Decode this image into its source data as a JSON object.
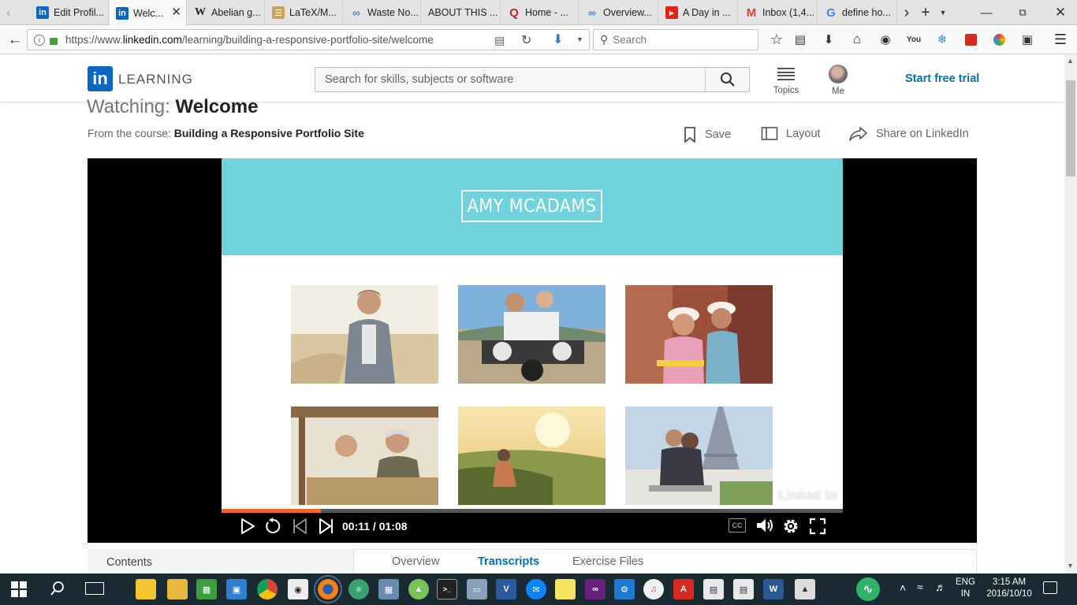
{
  "browser": {
    "tabs": [
      {
        "label": "Edit Profil...",
        "icon": "linkedin-icon",
        "active": false
      },
      {
        "label": "Welc...",
        "icon": "linkedin-icon",
        "active": true
      },
      {
        "label": "Abelian g...",
        "icon": "wikipedia-icon",
        "active": false
      },
      {
        "label": "LaTeX/M...",
        "icon": "wikibooks-icon",
        "active": false
      },
      {
        "label": "Waste No...",
        "icon": "link-icon",
        "active": false
      },
      {
        "label": "ABOUT THIS ...",
        "icon": "page-icon",
        "active": false
      },
      {
        "label": "Home - ...",
        "icon": "quora-icon",
        "active": false
      },
      {
        "label": "Overview...",
        "icon": "link-icon",
        "active": false
      },
      {
        "label": "A Day in ...",
        "icon": "youtube-icon",
        "active": false
      },
      {
        "label": "Inbox (1,4...",
        "icon": "gmail-icon",
        "active": false
      },
      {
        "label": "define ho...",
        "icon": "google-icon",
        "active": false
      }
    ],
    "url_prefix": "https://www.",
    "url_domain": "linkedin.com",
    "url_path": "/learning/building-a-responsive-portfolio-site/welcome",
    "search_placeholder": "Search"
  },
  "header": {
    "logo_text": "in",
    "brand": "LEARNING",
    "search_placeholder": "Search for skills, subjects or software",
    "topics_label": "Topics",
    "me_label": "Me",
    "trial_label": "Start free trial"
  },
  "course": {
    "watching_prefix": "Watching:",
    "video_title": "Welcome",
    "from_prefix": "From the course:",
    "course_title": "Building a Responsive Portfolio Site",
    "save_label": "Save",
    "layout_label": "Layout",
    "share_label": "Share on LinkedIn"
  },
  "video": {
    "slide_name": "AMY MCADAMS",
    "watermark": "Linked in",
    "current_time": "00:11",
    "total_time": "01:08",
    "progress": 0.16,
    "cc_label": "CC"
  },
  "tabs_below": {
    "contents_label": "Contents",
    "overview_label": "Overview",
    "transcripts_label": "Transcripts",
    "exercise_label": "Exercise Files",
    "active_tab": "Transcripts"
  },
  "taskbar": {
    "lang_top": "ENG",
    "lang_bottom": "IN",
    "time": "3:15 AM",
    "date": "2016/10/10"
  },
  "colors": {
    "linkedin_blue": "#0a66c2",
    "link_blue": "#0073b1",
    "slide_teal": "#6ed3dc",
    "progress_orange": "#f26522"
  }
}
